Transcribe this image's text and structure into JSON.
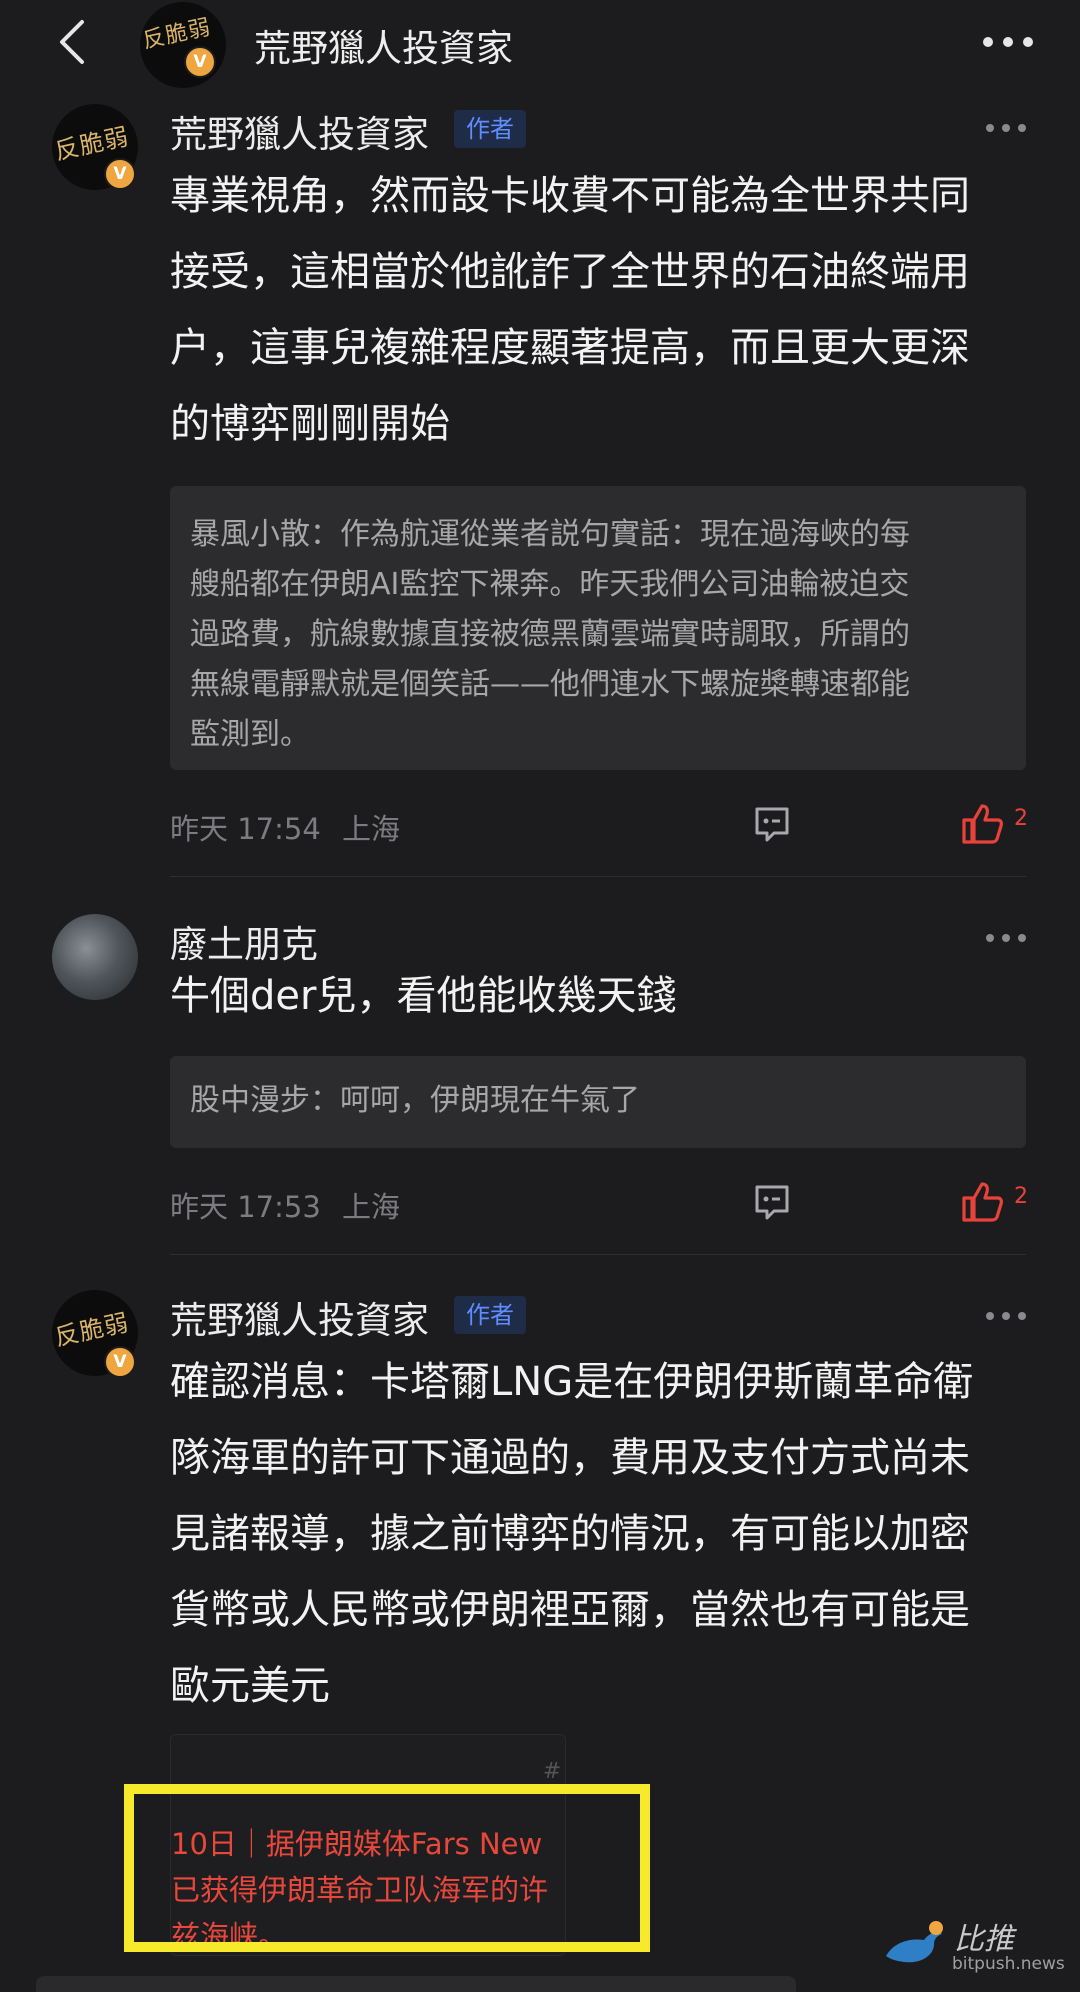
{
  "header": {
    "title": "荒野獵人投資家",
    "avatar_text": "反脆弱",
    "badge": "V"
  },
  "comments": [
    {
      "name": "荒野獵人投資家",
      "tag": "作者",
      "avatar_text": "反脆弱",
      "badge": "V",
      "lines": [
        "專業視角，然而設卡收費不可能為全世界共同",
        "接受，這相當於他訛詐了全世界的石油終端用",
        "户，這事兒複雜程度顯著提高，而且更大更深",
        "的博弈剛剛開始"
      ],
      "quote_lines": [
        "暴風小散：作為航運從業者説句實話：現在過海峽的每",
        "艘船都在伊朗AI監控下裸奔。昨天我們公司油輪被迫交",
        "過路費，航線數據直接被德黑蘭雲端實時調取，所謂的",
        "無線電靜默就是個笑話——他們連水下螺旋槳轉速都能",
        "監測到。"
      ],
      "time": "昨天 17:54",
      "location": "上海",
      "likes": "2"
    },
    {
      "name": "廢土朋克",
      "lines": [
        "牛個der兒，看他能收幾天錢"
      ],
      "quote_lines": [
        "股中漫步：呵呵，伊朗現在牛氣了"
      ],
      "time": "昨天 17:53",
      "location": "上海",
      "likes": "2"
    },
    {
      "name": "荒野獵人投資家",
      "tag": "作者",
      "avatar_text": "反脆弱",
      "badge": "V",
      "lines": [
        "確認消息：卡塔爾LNG是在伊朗伊斯蘭革命衛",
        "隊海軍的許可下通過的，費用及支付方式尚未",
        "見諸報導，據之前博弈的情況，有可能以加密",
        "貨幣或人民幣或伊朗裡亞爾，當然也有可能是",
        "歐元美元"
      ],
      "link_card": {
        "tag": "# ",
        "lines": [
          "10日｜据伊朗媒体Fars New",
          "已获得伊朗革命卫队海军的许",
          "兹海峡。"
        ]
      }
    }
  ],
  "watermark": {
    "title": "比推",
    "url": "bitpush.news"
  },
  "colors": {
    "background": "#1c1c1e",
    "author_tag_bg": "#1f2c48",
    "author_tag_text": "#5f8dff",
    "like_red": "#e8433a",
    "highlight_yellow": "#f6ea2a"
  },
  "icons": [
    "back-icon",
    "more-icon",
    "reply-icon",
    "thumbs-up-icon",
    "verified-badge-icon"
  ]
}
